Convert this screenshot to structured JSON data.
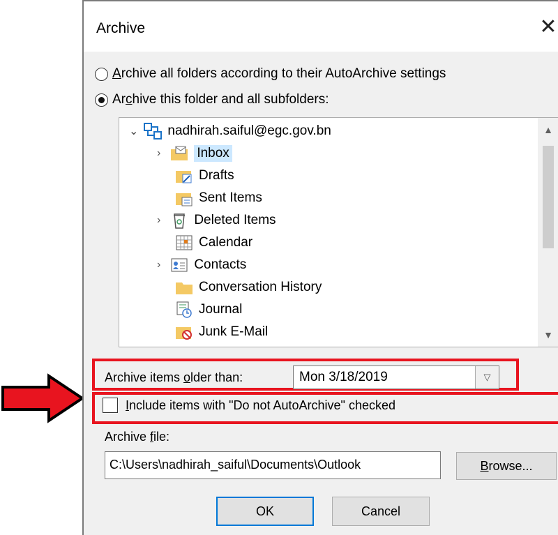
{
  "window": {
    "title": "Archive",
    "close_glyph": "✕"
  },
  "options": {
    "archive_all": {
      "accesskey": "A",
      "label_rest": "rchive all folders according to their AutoArchive settings",
      "checked": false
    },
    "archive_this": {
      "prefix": "Ar",
      "accesskey": "c",
      "label_rest": "hive this folder and all subfolders:",
      "checked": true
    }
  },
  "folder_tree": {
    "account": "nadhirah.saiful@egc.gov.bn",
    "items": [
      {
        "label": "Inbox",
        "icon": "inbox-folder-icon",
        "expandable": true,
        "selected": true
      },
      {
        "label": "Drafts",
        "icon": "drafts-folder-icon",
        "expandable": false
      },
      {
        "label": "Sent Items",
        "icon": "sent-items-folder-icon",
        "expandable": false
      },
      {
        "label": "Deleted Items",
        "icon": "recycle-bin-icon",
        "expandable": true
      },
      {
        "label": "Calendar",
        "icon": "calendar-icon",
        "expandable": false
      },
      {
        "label": "Contacts",
        "icon": "contacts-card-icon",
        "expandable": true
      },
      {
        "label": "Conversation History",
        "icon": "folder-icon",
        "expandable": false
      },
      {
        "label": "Journal",
        "icon": "journal-icon",
        "expandable": false
      },
      {
        "label": "Junk E-Mail",
        "icon": "junk-mail-folder-icon",
        "expandable": false
      }
    ]
  },
  "archive_older": {
    "label_prefix": "Archive items ",
    "accesskey": "o",
    "label_rest": "lder than:",
    "value": "Mon 3/18/2019"
  },
  "include_do_not": {
    "accesskey": "I",
    "label_rest": "nclude items with \"Do not AutoArchive\" checked",
    "checked": false
  },
  "archive_file": {
    "label_prefix": "Archive ",
    "accesskey": "f",
    "label_rest": "ile:",
    "path": "C:\\Users\\nadhirah_saiful\\Documents\\Outlook"
  },
  "buttons": {
    "browse_accesskey": "B",
    "browse_rest": "rowse...",
    "ok": "OK",
    "cancel": "Cancel"
  },
  "colors": {
    "highlight_red": "#e8141f",
    "selection_blue": "#cce8ff",
    "folder_yellow": "#f4c964",
    "accent_blue": "#0078d7"
  }
}
